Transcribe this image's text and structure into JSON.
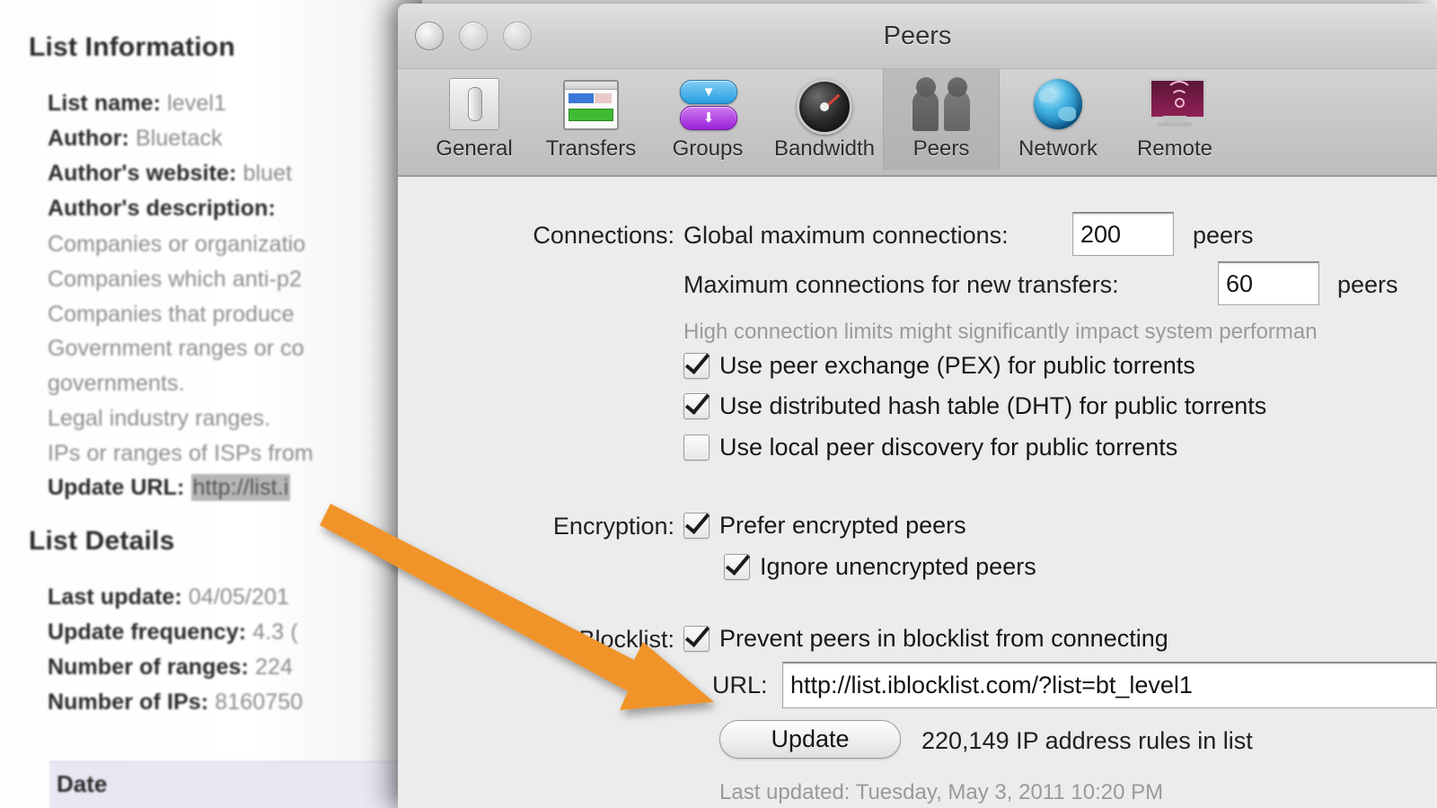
{
  "background_document": {
    "heading_1": "List Information",
    "info_rows": [
      {
        "label": "List name:",
        "value": "level1"
      },
      {
        "label": "Author:",
        "value": "Bluetack"
      },
      {
        "label": "Author's website:",
        "value": "bluet"
      }
    ],
    "description_label": "Author's description:",
    "description_lines": [
      "Companies or organizatio",
      "Companies which anti-p2",
      "Companies that produce ",
      "Government ranges or co",
      "governments.",
      "Legal industry ranges.",
      "IPs or ranges of ISPs from"
    ],
    "update_url_label": "Update URL:",
    "update_url_value": "http://list.i",
    "heading_2": "List Details",
    "detail_rows": [
      {
        "label": "Last update:",
        "value": "04/05/201"
      },
      {
        "label": "Update frequency:",
        "value": "4.3 ("
      },
      {
        "label": "Number of ranges:",
        "value": "224"
      },
      {
        "label": "Number of IPs:",
        "value": "8160750"
      }
    ],
    "table_header": "Date"
  },
  "window": {
    "title": "Peers",
    "traffic_lights": [
      "close-button",
      "minimize-button",
      "zoom-button"
    ]
  },
  "toolbar": {
    "items": [
      {
        "label": "General",
        "icon": "general-icon",
        "selected": false
      },
      {
        "label": "Transfers",
        "icon": "transfers-icon",
        "selected": false
      },
      {
        "label": "Groups",
        "icon": "groups-icon",
        "selected": false
      },
      {
        "label": "Bandwidth",
        "icon": "bandwidth-icon",
        "selected": false
      },
      {
        "label": "Peers",
        "icon": "peers-icon",
        "selected": true
      },
      {
        "label": "Network",
        "icon": "network-icon",
        "selected": false
      },
      {
        "label": "Remote",
        "icon": "remote-icon",
        "selected": false
      }
    ]
  },
  "connections": {
    "section_label": "Connections:",
    "global_max_label": "Global maximum connections:",
    "global_max_value": "200",
    "global_max_unit": "peers",
    "new_transfers_label": "Maximum connections for new transfers:",
    "new_transfers_value": "60",
    "new_transfers_unit": "peers",
    "hint": "High connection limits might significantly impact system performan",
    "checkboxes": [
      {
        "label": "Use peer exchange (PEX) for public torrents",
        "checked": true
      },
      {
        "label": "Use distributed hash table (DHT) for public torrents",
        "checked": true
      },
      {
        "label": "Use local peer discovery for public torrents",
        "checked": false
      }
    ]
  },
  "encryption": {
    "section_label": "Encryption:",
    "checkboxes": [
      {
        "label": "Prefer encrypted peers",
        "checked": true
      },
      {
        "label": "Ignore unencrypted peers",
        "checked": true
      }
    ]
  },
  "blocklist": {
    "section_label": "Blocklist:",
    "prevent_checkbox": {
      "label": "Prevent peers in blocklist from connecting",
      "checked": true
    },
    "url_label": "URL:",
    "url_value": "http://list.iblocklist.com/?list=bt_level1",
    "update_button": "Update",
    "rules_status": "220,149 IP address rules in list",
    "last_updated": "Last updated: Tuesday, May 3, 2011 10:20 PM"
  },
  "annotation": {
    "type": "arrow",
    "color": "#F0942B",
    "from": "Update URL value in background document",
    "to": "Blocklist URL field"
  }
}
